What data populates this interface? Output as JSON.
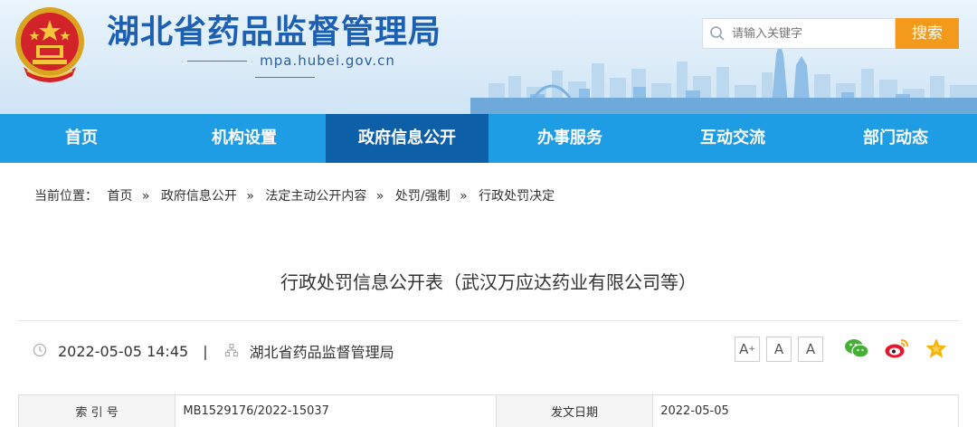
{
  "header": {
    "title": "湖北省药品监督管理局",
    "domain": "mpa.hubei.gov.cn"
  },
  "search": {
    "placeholder": "请输入关键字",
    "button_label": "搜索"
  },
  "nav": {
    "items": [
      {
        "label": "首页"
      },
      {
        "label": "机构设置"
      },
      {
        "label": "政府信息公开"
      },
      {
        "label": "办事服务"
      },
      {
        "label": "互动交流"
      },
      {
        "label": "部门动态"
      }
    ],
    "active_index": 2
  },
  "breadcrumb": {
    "prefix": "当前位置：",
    "sep": "»",
    "items": [
      "首页",
      "政府信息公开",
      "法定主动公开内容",
      "处罚/强制",
      "行政处罚决定"
    ]
  },
  "article": {
    "title": "行政处罚信息公开表（武汉万应达药业有限公司等）",
    "datetime": "2022-05-05 14:45",
    "pipe": "|",
    "publisher": "湖北省药品监督管理局"
  },
  "font_size": {
    "large": "A",
    "large_mark": "+",
    "medium": "A",
    "small": "A"
  },
  "share": {
    "icons": [
      "wechat-icon",
      "weibo-icon",
      "favorite-icon"
    ]
  },
  "info_table": {
    "index_label": "索 引 号",
    "index_value": "MB1529176/2022-15037",
    "date_label": "发文日期",
    "date_value": "2022-05-05"
  },
  "colors": {
    "nav_bg": "#1e9ce4",
    "nav_active": "#0d5fa8",
    "search_button": "#f39a1d",
    "title_blue": "#1d5fb0"
  }
}
